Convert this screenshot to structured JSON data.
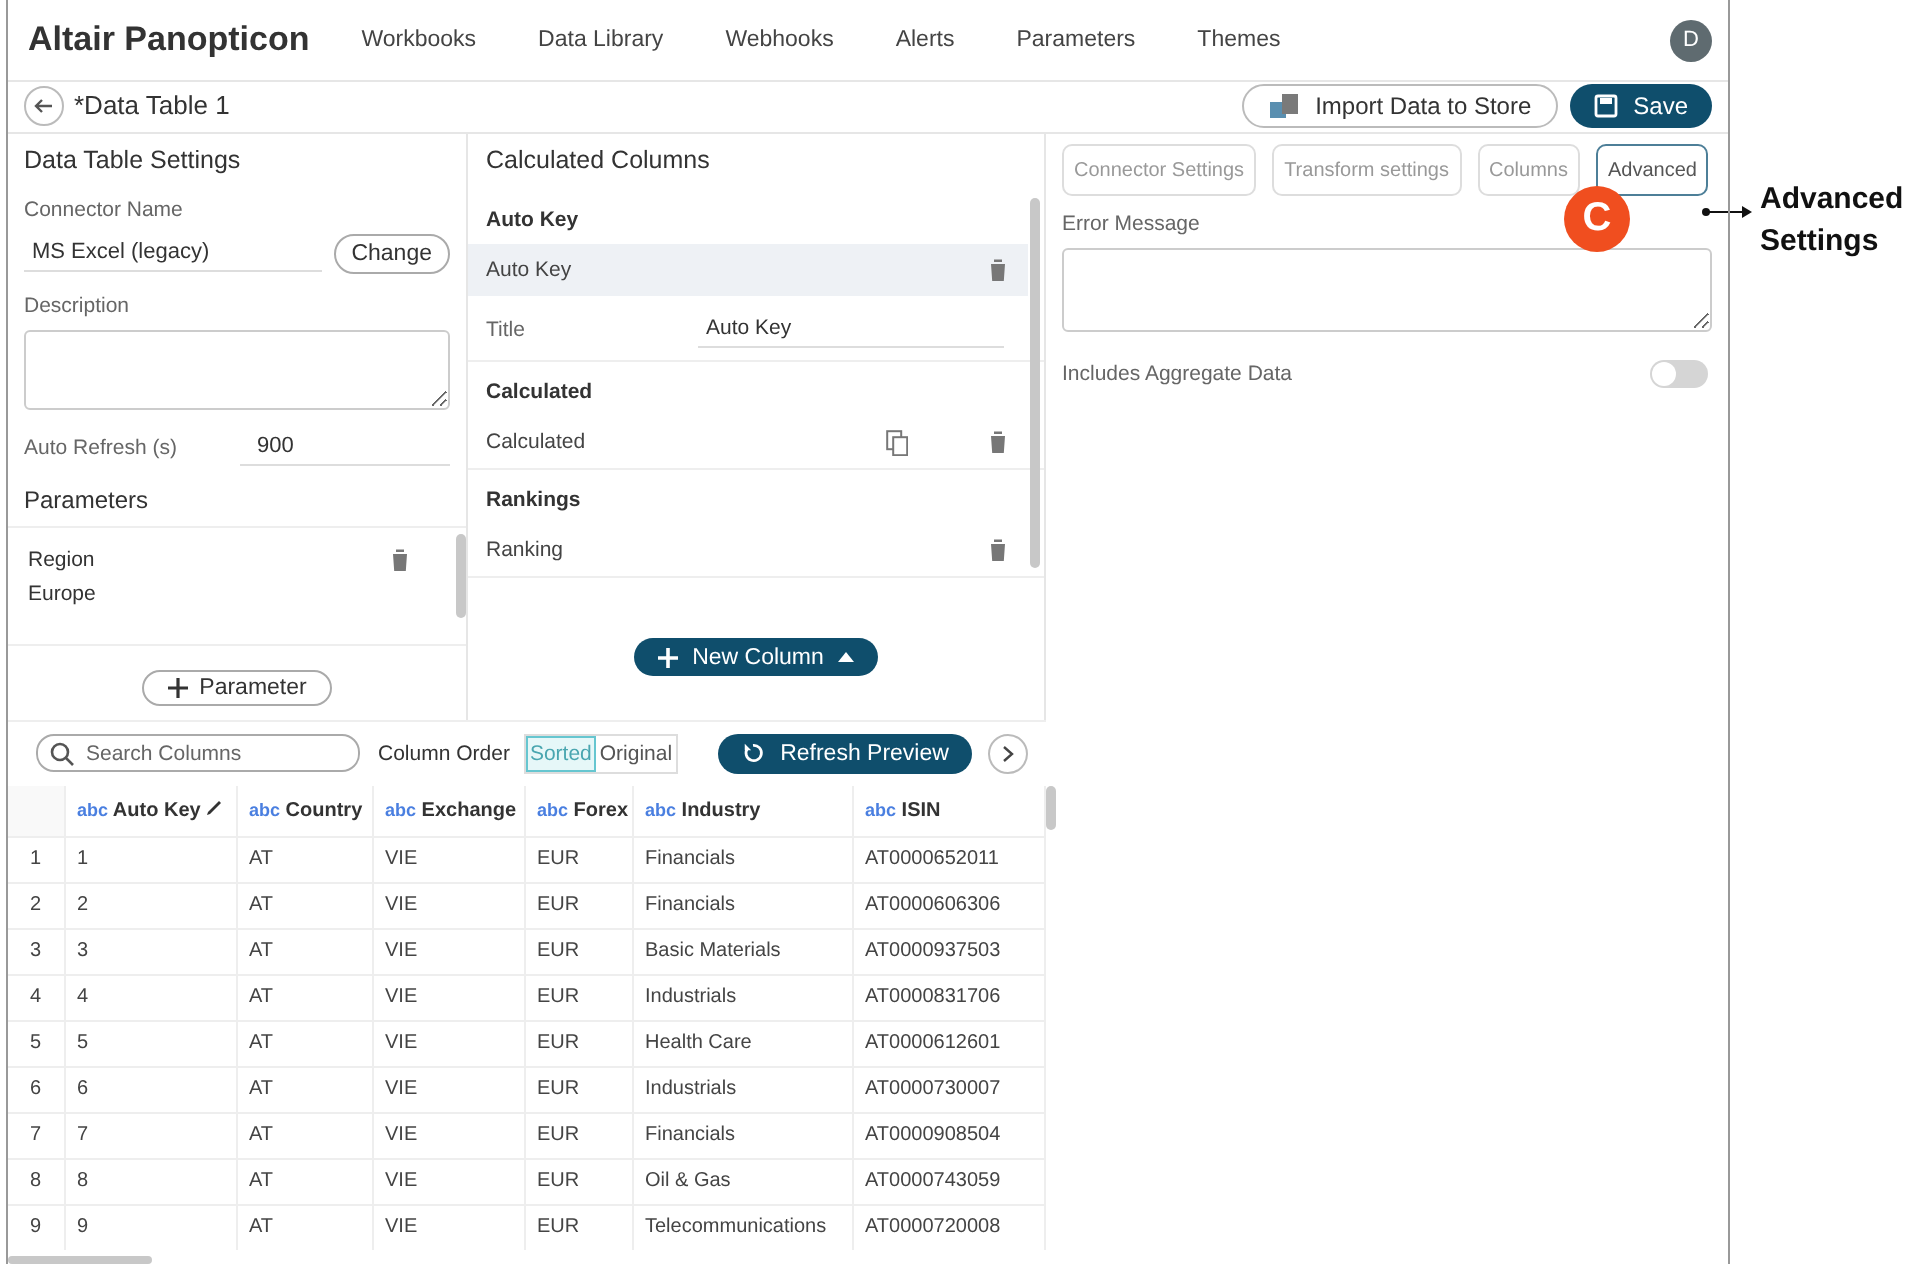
{
  "app": {
    "brand": "Altair Panopticon",
    "nav": [
      "Workbooks",
      "Data Library",
      "Webhooks",
      "Alerts",
      "Parameters",
      "Themes"
    ],
    "avatar": "D"
  },
  "header": {
    "title": "*Data Table 1",
    "buttons": [
      {
        "label": "Import Data to Store",
        "kind": "outline"
      },
      {
        "label": "Save",
        "kind": "primary"
      }
    ]
  },
  "settings": {
    "title": "Data Table Settings",
    "connector_label": "Connector Name",
    "connector_value": "MS Excel (legacy)",
    "change_button": "Change",
    "description_label": "Description",
    "auto_refresh_label": "Auto Refresh (s)",
    "auto_refresh_value": "900",
    "parameters_title": "Parameters",
    "parameters": [
      {
        "name": "Region",
        "value": "Europe"
      }
    ],
    "add_parameter": "Parameter"
  },
  "calculated": {
    "title": "Calculated Columns",
    "groups": [
      {
        "heading": "Auto Key",
        "items": [
          {
            "name": "Auto Key",
            "selected": true,
            "copy": false
          }
        ],
        "detail": {
          "label": "Title",
          "value": "Auto Key"
        }
      },
      {
        "heading": "Calculated",
        "items": [
          {
            "name": "Calculated",
            "selected": false,
            "copy": true
          }
        ]
      },
      {
        "heading": "Rankings",
        "items": [
          {
            "name": "Ranking",
            "selected": false,
            "copy": false
          }
        ]
      }
    ],
    "new_column": "New Column"
  },
  "advanced": {
    "tabs": [
      {
        "label": "Connector Settings",
        "selected": false
      },
      {
        "label": "Transform settings",
        "selected": false
      },
      {
        "label": "Columns",
        "selected": false
      },
      {
        "label": "Advanced",
        "selected": true
      }
    ],
    "error_label": "Error Message",
    "aggregate_label": "Includes Aggregate Data",
    "aggregate_on": false
  },
  "preview": {
    "search_placeholder": "Search Columns",
    "order_label": "Column Order",
    "order_options": [
      {
        "label": "Sorted",
        "selected": true
      },
      {
        "label": "Original",
        "selected": false
      }
    ],
    "refresh": "Refresh Preview",
    "columns": [
      {
        "kind": "index"
      },
      {
        "type": "abc",
        "name": "Auto Key",
        "editable": true
      },
      {
        "type": "abc",
        "name": "Country",
        "editable": false
      },
      {
        "type": "abc",
        "name": "Exchange",
        "editable": false
      },
      {
        "type": "abc",
        "name": "Forex",
        "editable": false
      },
      {
        "type": "abc",
        "name": "Industry",
        "editable": false
      },
      {
        "type": "abc",
        "name": "ISIN",
        "editable": false
      }
    ],
    "rows": [
      [
        "1",
        "1",
        "AT",
        "VIE",
        "EUR",
        "Financials",
        "AT0000652011"
      ],
      [
        "2",
        "2",
        "AT",
        "VIE",
        "EUR",
        "Financials",
        "AT0000606306"
      ],
      [
        "3",
        "3",
        "AT",
        "VIE",
        "EUR",
        "Basic Materials",
        "AT0000937503"
      ],
      [
        "4",
        "4",
        "AT",
        "VIE",
        "EUR",
        "Industrials",
        "AT0000831706"
      ],
      [
        "5",
        "5",
        "AT",
        "VIE",
        "EUR",
        "Health Care",
        "AT0000612601"
      ],
      [
        "6",
        "6",
        "AT",
        "VIE",
        "EUR",
        "Industrials",
        "AT0000730007"
      ],
      [
        "7",
        "7",
        "AT",
        "VIE",
        "EUR",
        "Financials",
        "AT0000908504"
      ],
      [
        "8",
        "8",
        "AT",
        "VIE",
        "EUR",
        "Oil & Gas",
        "AT0000743059"
      ],
      [
        "9",
        "9",
        "AT",
        "VIE",
        "EUR",
        "Telecommunications",
        "AT0000720008"
      ]
    ]
  },
  "callout": {
    "badge": "C",
    "label": "Advanced Settings"
  }
}
